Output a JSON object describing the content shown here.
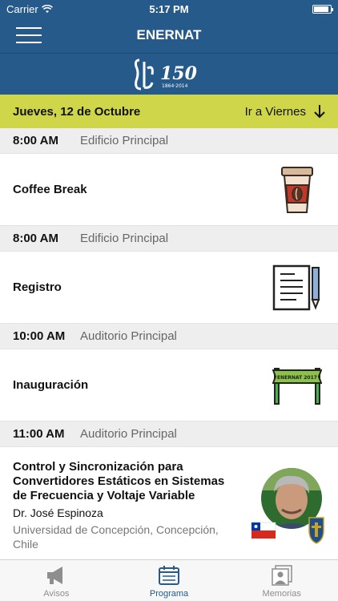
{
  "status": {
    "carrier": "Carrier",
    "time": "5:17 PM",
    "battery_level": 0.9
  },
  "nav": {
    "title": "ENERNAT"
  },
  "logo": {
    "number": "150",
    "years": "1864·2014"
  },
  "day": {
    "current": "Jueves, 12 de Octubre",
    "next_label": "Ir a Viernes"
  },
  "events": [
    {
      "time": "8:00 AM",
      "location": "Edificio Principal",
      "title": "Coffee Break",
      "icon": "coffee-cup-icon"
    },
    {
      "time": "8:00 AM",
      "location": "Edificio Principal",
      "title": "Registro",
      "icon": "document-pen-icon"
    },
    {
      "time": "10:00 AM",
      "location": "Auditorio Principal",
      "title": "Inauguración",
      "icon": "banner-icon",
      "banner_text": "ENERNAT 2017"
    },
    {
      "time": "11:00 AM",
      "location": "Auditorio Principal",
      "title": "Control y Sincronización para Convertidores Estáticos en Sistemas de Frecuencia y Voltaje Variable",
      "speaker": "Dr. José Espinoza",
      "affiliation": "Universidad de Concepción, Concepción, Chile"
    }
  ],
  "tabs": [
    {
      "label": "Avisos",
      "icon": "megaphone-icon"
    },
    {
      "label": "Programa",
      "icon": "calendar-icon"
    },
    {
      "label": "Memorias",
      "icon": "photo-stack-icon"
    }
  ],
  "colors": {
    "brand": "#265a8a",
    "day_bar": "#cfd64a",
    "section_bg": "#eeeeee"
  }
}
